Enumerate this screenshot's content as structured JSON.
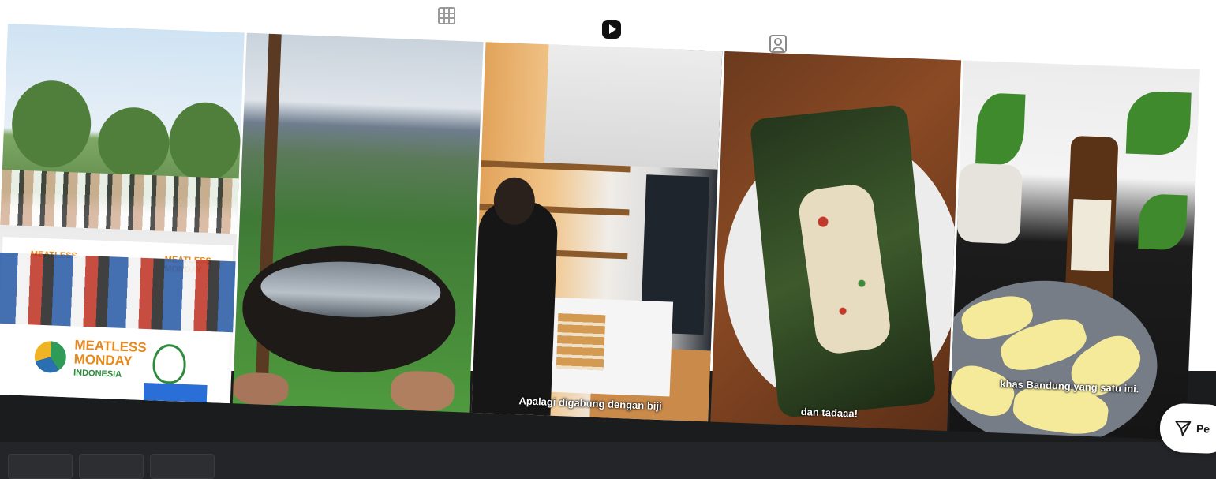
{
  "tabs": [
    {
      "name": "grid-icon",
      "active": false
    },
    {
      "name": "reels-icon",
      "active": true
    },
    {
      "name": "tagged-icon",
      "active": false
    }
  ],
  "reels": [
    {
      "scene": "Meatless Monday Indonesia campaign group photo",
      "brand_title": "MEATLESS MONDAY",
      "brand_sub": "INDONESIA",
      "banner_small_left": "MEATLESS",
      "banner_small_right": "MEATLESS MONDAY",
      "caption": ""
    },
    {
      "scene": "coconut shell bowl overlooking rice terraces",
      "caption": ""
    },
    {
      "scene": "bakery interior with pastry counter",
      "caption": "Apalagi digabung dengan biji"
    },
    {
      "scene": "pepes wrapped in banana leaf on white plate",
      "caption": "dan tadaaa!"
    },
    {
      "scene": "fried cassava with plants and bottle",
      "caption": "khas Bandung yang satu ini."
    }
  ],
  "share_button": {
    "label": "Pe"
  },
  "colors": {
    "accent_orange": "#e8891b",
    "brand_green": "#2e8b3d",
    "text_dark": "#1a1a1a"
  }
}
